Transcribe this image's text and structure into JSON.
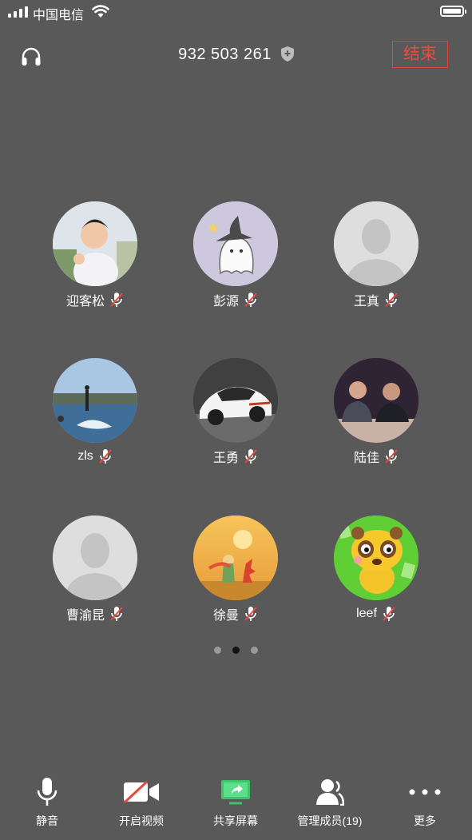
{
  "status_bar": {
    "carrier": "中国电信"
  },
  "header": {
    "meeting_id": "932 503 261",
    "end_label": "结束"
  },
  "participants": [
    {
      "name": "迎客松",
      "avatar": "child-photo"
    },
    {
      "name": "彭源",
      "avatar": "ghost-wizard-cartoon"
    },
    {
      "name": "王真",
      "avatar": "default-silhouette"
    },
    {
      "name": "zls",
      "avatar": "jetski-sea-photo"
    },
    {
      "name": "王勇",
      "avatar": "white-sports-car-photo"
    },
    {
      "name": "陆佳",
      "avatar": "couple-night-photo"
    },
    {
      "name": "曹渝昆",
      "avatar": "default-silhouette"
    },
    {
      "name": "徐曼",
      "avatar": "little-prince-illustration"
    },
    {
      "name": "leef",
      "avatar": "yellow-cartoon-animal"
    }
  ],
  "pager": {
    "current_page": 2,
    "total_pages": 3
  },
  "toolbar": {
    "mute_label": "静音",
    "video_label": "开启视频",
    "share_label": "共享屏幕",
    "members_label": "管理成员(19)",
    "more_label": "更多"
  },
  "colors": {
    "background": "#595959",
    "end_red": "#ee4a40",
    "share_green": "#3ec26a",
    "muted_red": "#e64a3f"
  }
}
